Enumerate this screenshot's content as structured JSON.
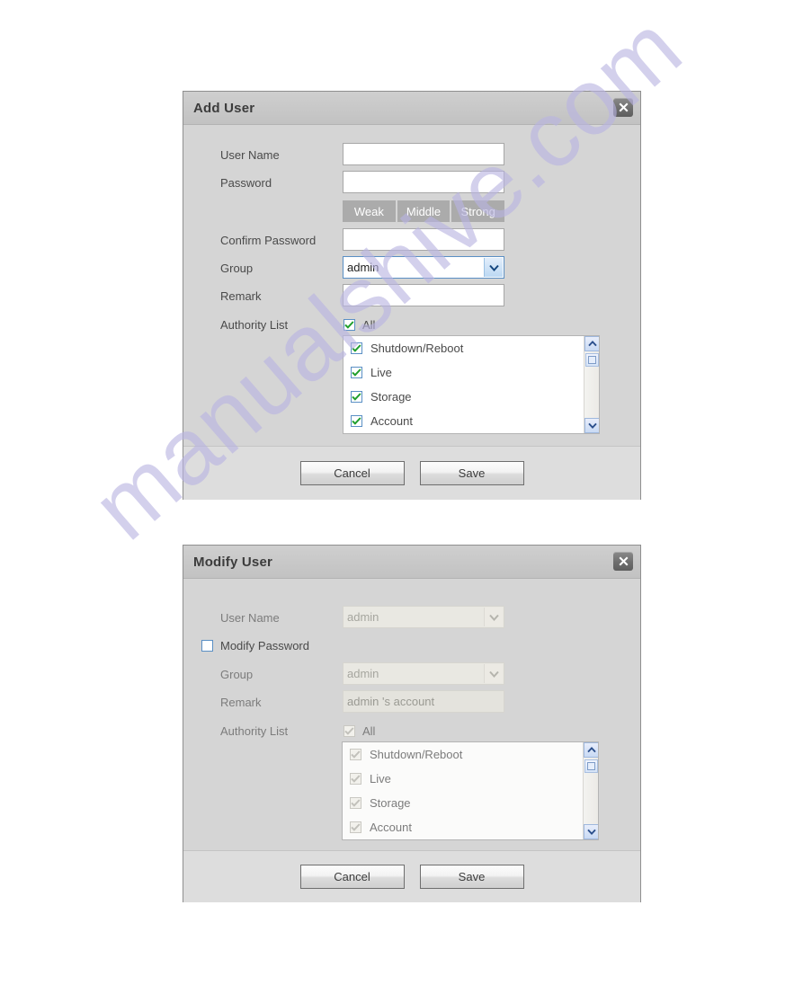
{
  "watermark": {
    "text": "manualshive.com",
    "color": "#b9b4e2"
  },
  "add_user": {
    "title": "Add User",
    "close_icon": "close-icon",
    "fields": {
      "user_name_label": "User Name",
      "user_name_value": "",
      "password_label": "Password",
      "password_value": "",
      "confirm_password_label": "Confirm Password",
      "confirm_password_value": "",
      "group_label": "Group",
      "group_value": "admin",
      "remark_label": "Remark",
      "remark_value": "",
      "authority_list_label": "Authority List",
      "all_label": "All"
    },
    "strength": {
      "weak": "Weak",
      "middle": "Middle",
      "strong": "Strong"
    },
    "authority_items": [
      {
        "label": "Shutdown/Reboot",
        "checked": true
      },
      {
        "label": "Live",
        "checked": true
      },
      {
        "label": "Storage",
        "checked": true
      },
      {
        "label": "Account",
        "checked": true
      }
    ],
    "buttons": {
      "cancel": "Cancel",
      "save": "Save"
    }
  },
  "modify_user": {
    "title": "Modify User",
    "close_icon": "close-icon",
    "fields": {
      "user_name_label": "User Name",
      "user_name_value": "admin",
      "modify_password_label": "Modify Password",
      "group_label": "Group",
      "group_value": "admin",
      "remark_label": "Remark",
      "remark_value": "admin 's account",
      "authority_list_label": "Authority List",
      "all_label": "All"
    },
    "authority_items": [
      {
        "label": "Shutdown/Reboot",
        "checked": true
      },
      {
        "label": "Live",
        "checked": true
      },
      {
        "label": "Storage",
        "checked": true
      },
      {
        "label": "Account",
        "checked": true
      }
    ],
    "buttons": {
      "cancel": "Cancel",
      "save": "Save"
    }
  }
}
